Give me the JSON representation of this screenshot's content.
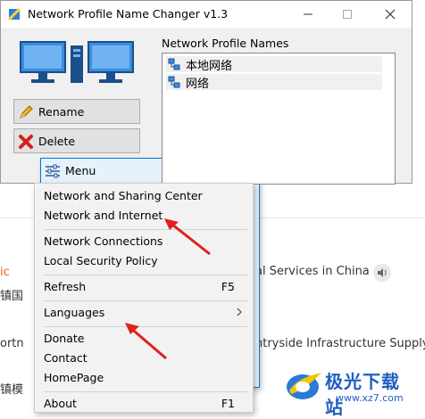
{
  "window": {
    "title": "Network Profile Name Changer v1.3",
    "controls": [
      "minimize",
      "maximize",
      "close"
    ]
  },
  "left_panel": {
    "buttons": [
      {
        "label": "Rename",
        "icon": "pencil-icon"
      },
      {
        "label": "Delete",
        "icon": "red-x-icon"
      },
      {
        "label": "Menu",
        "icon": "sliders-icon"
      }
    ]
  },
  "list": {
    "label": "Network Profile Names",
    "items": [
      "本地网络",
      "网络"
    ]
  },
  "context_menu": {
    "items": [
      {
        "label": "Network and Sharing Center",
        "shortcut": ""
      },
      {
        "label": "Network and Internet",
        "shortcut": ""
      },
      {
        "label": "Network Connections",
        "shortcut": ""
      },
      {
        "label": "Local Security Policy",
        "shortcut": ""
      },
      {
        "label": "Refresh",
        "shortcut": "F5"
      },
      {
        "label": "Languages",
        "shortcut": "",
        "submenu": true
      },
      {
        "label": "Donate",
        "shortcut": ""
      },
      {
        "label": "Contact",
        "shortcut": ""
      },
      {
        "label": "HomePage",
        "shortcut": ""
      },
      {
        "label": "About",
        "shortcut": "F1"
      }
    ]
  },
  "background": {
    "fragments": [
      "ic",
      "al Services in China",
      "ntryside Infrastructure Supply",
      "ortn",
      "镇国",
      "镇模"
    ]
  },
  "watermark": {
    "text": "极光下载站",
    "url": "www.xz7.com"
  },
  "colors": {
    "accent": "#0078d7",
    "annotation_arrow": "#e02020",
    "orange_fragment": "#e8621a"
  }
}
